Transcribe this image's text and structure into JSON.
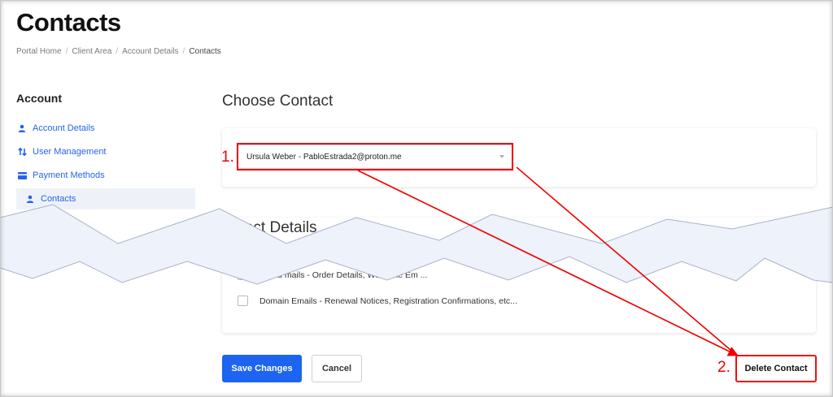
{
  "page": {
    "title": "Contacts"
  },
  "breadcrumb": [
    "Portal Home",
    "Client Area",
    "Account Details",
    "Contacts"
  ],
  "sidebar": {
    "heading": "Account",
    "items": [
      {
        "label": "Account Details",
        "icon": "user-icon",
        "active": false
      },
      {
        "label": "User Management",
        "icon": "swap-arrows-icon",
        "active": false
      },
      {
        "label": "Payment Methods",
        "icon": "card-icon",
        "active": false
      },
      {
        "label": "Contacts",
        "icon": "user-icon",
        "active": true
      }
    ]
  },
  "choose_contact": {
    "title": "Choose Contact",
    "selected_value": "Ursula Weber - PabloEstrada2@proton.me"
  },
  "contact_details": {
    "title_visible": "ntact Details",
    "options": [
      {
        "label": "Product Emails - Order Details, Welcome Emails...",
        "label_visible": "Produ     mails - Order Details, Welcome Em    ..."
      },
      {
        "label": "Domain Emails - Renewal Notices, Registration Confirmations, etc...",
        "label_visible": "Domain Emails - Renewal Notices, Registration Confirmations, etc..."
      }
    ]
  },
  "buttons": {
    "save": "Save Changes",
    "cancel": "Cancel",
    "delete": "Delete Contact"
  },
  "annotations": {
    "step1": "1.",
    "step2": "2."
  },
  "colors": {
    "primary": "#1d64f2",
    "link": "#2563eb",
    "annotation": "#e00000",
    "torn_fill": "#eef2fb"
  }
}
